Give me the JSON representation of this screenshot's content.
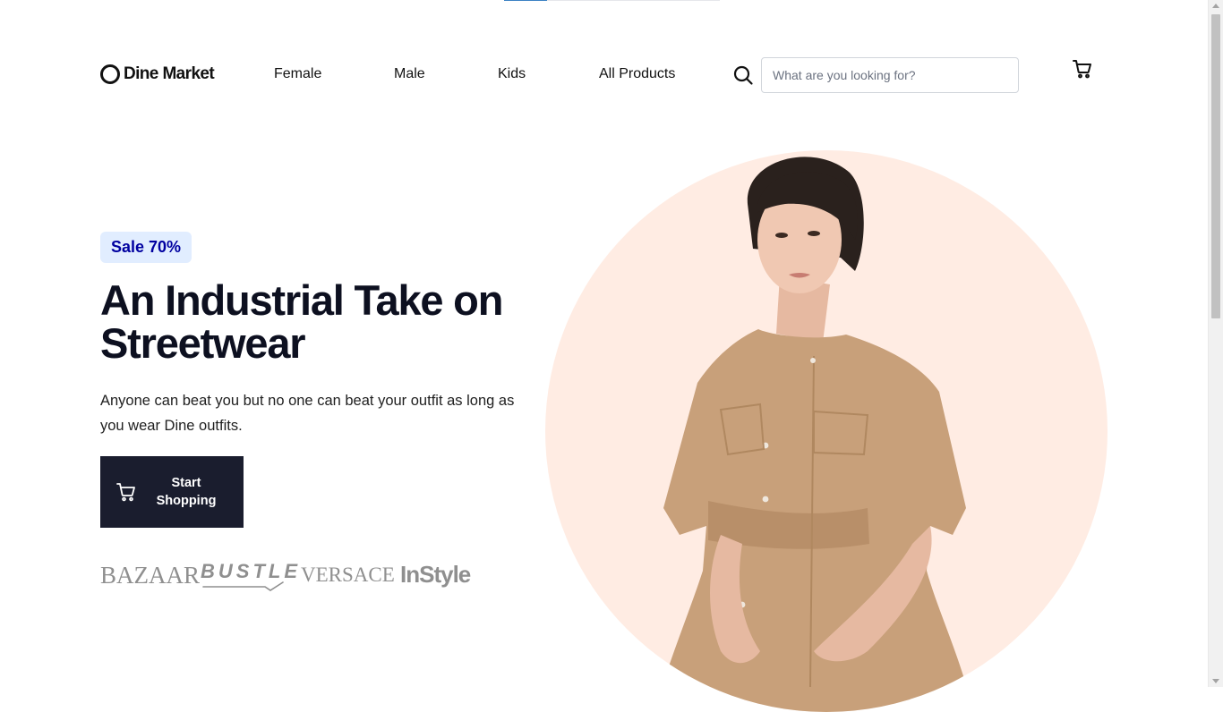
{
  "header": {
    "logo_text": "Dine Market",
    "nav": [
      {
        "label": "Female"
      },
      {
        "label": "Male"
      },
      {
        "label": "Kids"
      },
      {
        "label": "All Products"
      }
    ],
    "search": {
      "placeholder": "What are you looking for?",
      "value": ""
    },
    "icons": {
      "search": "search-icon",
      "cart": "cart-icon"
    }
  },
  "page_progress": 0.2,
  "hero": {
    "badge": "Sale 70%",
    "title": "An Industrial Take on Streetwear",
    "subtitle": "Anyone can beat you but no one can beat your outfit as long as you wear Dine outfits.",
    "cta_label": "Start Shopping",
    "cta_icon": "cart-icon",
    "brands": [
      "BAZAAR",
      "BUSTLE",
      "VERSACE",
      "InStyle"
    ],
    "image_alt": "woman in beige dress"
  },
  "colors": {
    "accent_dark": "#1a1d2e",
    "badge_bg": "#e1edff",
    "badge_text": "#0000a0",
    "hero_circle": "#ffece3",
    "brand_gray": "#8f8f8f"
  }
}
